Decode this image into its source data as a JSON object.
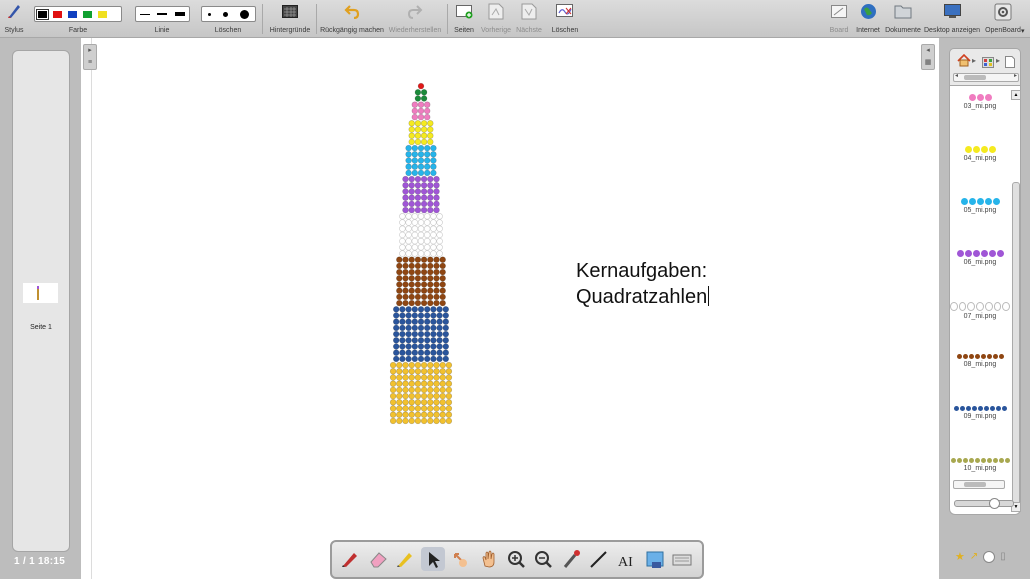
{
  "toolbar": {
    "stylus": "Stylus",
    "farbe": "Farbe",
    "linie": "Linie",
    "loeschen": "Löschen",
    "hintergruende": "Hintergründe",
    "rueckgaengig": "Rückgängig machen",
    "wiederherstellen": "Wiederherstellen",
    "seiten": "Seiten",
    "vorherige": "Vorherige",
    "naechste": "Nächste",
    "loeschen2": "Löschen",
    "board": "Board",
    "internet": "Internet",
    "dokumente": "Dokumente",
    "desktop": "Desktop anzeigen",
    "openboard": "OpenBoard"
  },
  "colors": {
    "swatches": [
      "#000000",
      "#e01010",
      "#1040c0",
      "#10a030",
      "#f0e020"
    ],
    "tower_rows": [
      "#e01818",
      "#1b8a3a",
      "#f07cc0",
      "#f5ea20",
      "#26b4ea",
      "#a056d6",
      "#ffffff",
      "#8f4612",
      "#2a559c",
      "#f2c12e"
    ]
  },
  "left": {
    "page_label": "Seite 1",
    "status": "1 / 1  18:15"
  },
  "board": {
    "line1": "Kernaufgaben:",
    "line2": "Quadratzahlen"
  },
  "library": {
    "items": [
      {
        "name": "03_mi.png",
        "color": "#f07cc0",
        "count": 3
      },
      {
        "name": "04_mi.png",
        "color": "#f5ea20",
        "count": 4
      },
      {
        "name": "05_mi.png",
        "color": "#26b4ea",
        "count": 5
      },
      {
        "name": "06_mi.png",
        "color": "#a056d6",
        "count": 6
      },
      {
        "name": "07_mi.png",
        "color": "#ffffff",
        "count": 7
      },
      {
        "name": "08_mi.png",
        "color": "#8f4612",
        "count": 8
      },
      {
        "name": "09_mi.png",
        "color": "#2a559c",
        "count": 9
      },
      {
        "name": "10_mi.png",
        "color": "#a8a850",
        "count": 10
      }
    ]
  },
  "bottom_tools": [
    "pen-icon",
    "eraser-icon",
    "marker-icon",
    "selector-icon",
    "interact-icon",
    "hand-icon",
    "zoom-in-icon",
    "zoom-out-icon",
    "laser-icon",
    "line-icon",
    "text-icon",
    "capture-icon",
    "keyboard-icon"
  ]
}
